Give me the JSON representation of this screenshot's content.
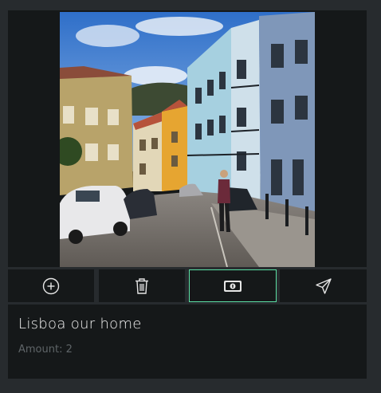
{
  "post": {
    "title": "Lisboa our home",
    "amount_label": "Amount: ",
    "amount_value": "2",
    "photo_icon": "street-photo"
  },
  "actions": [
    {
      "name": "add",
      "icon": "plus-circle-icon"
    },
    {
      "name": "delete",
      "icon": "trash-icon"
    },
    {
      "name": "money",
      "icon": "banknote-icon",
      "active": true
    },
    {
      "name": "send",
      "icon": "paper-plane-icon"
    }
  ],
  "colors": {
    "background": "#272b2e",
    "panel": "#151819",
    "accent": "#5be0a4",
    "title": "#f2f2f2",
    "muted": "#5f6568"
  }
}
